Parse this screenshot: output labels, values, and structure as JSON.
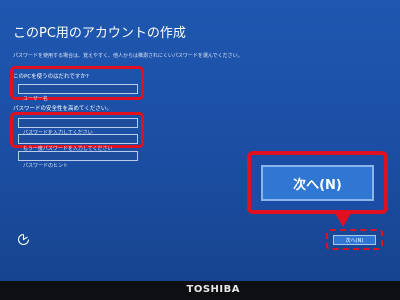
{
  "page": {
    "title": "このPC用のアカウントの作成",
    "description": "パスワードを使用する場合は、覚えやすく、他人からは推測されにくいパスワードを選んでください。"
  },
  "form": {
    "username_label": "このPCを使うのはだれですか?",
    "username_placeholder": "ユーザー名",
    "password_section_label": "パスワードの安全性を高めてください。",
    "password_placeholder": "パスワードを入力してください",
    "password_confirm_placeholder": "もう一度パスワードを入力してください",
    "password_hint_placeholder": "パスワードのヒント"
  },
  "buttons": {
    "next_zoomed_label": "次へ(N)",
    "next_label": "次へ(N)"
  },
  "device": {
    "brand": "TOSHIBA"
  },
  "colors": {
    "background": "#1b4ea3",
    "highlight": "#e01020",
    "button": "#2f77d2"
  },
  "icons": {
    "accessibility": "accessibility-icon"
  }
}
